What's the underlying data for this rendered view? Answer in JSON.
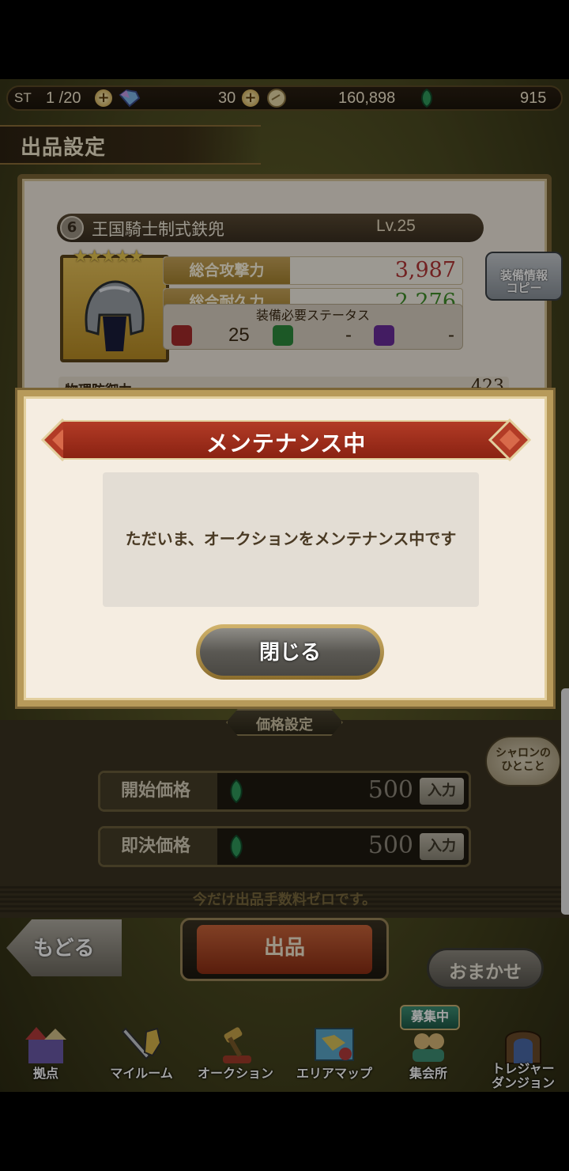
{
  "status": {
    "st_label": "ST",
    "stamina": "1 /20",
    "gems": "30",
    "gold": "160,898",
    "emeralds": "915"
  },
  "header": {
    "title": "出品設定"
  },
  "item": {
    "rank": "6",
    "name": "王国騎士制式鉄兜",
    "level": "Lv.25",
    "stars": "★★★★★",
    "stats": [
      {
        "label": "総合攻撃力",
        "value": "3,987",
        "color": "#b23636"
      },
      {
        "label": "総合耐久力",
        "value": "2,276",
        "color": "#3f8f2a"
      }
    ],
    "requirements": {
      "title": "装備必要ステータス",
      "str": "25",
      "dex": "-",
      "int": "-"
    },
    "defense": {
      "label": "物理防御力",
      "value": "423"
    },
    "copy_button": "装備情報\nコピー"
  },
  "dialog": {
    "title": "メンテナンス中",
    "message": "ただいま、オークションをメンテナンス中です",
    "close_button": "閉じる"
  },
  "price": {
    "tab": "価格設定",
    "start_label": "開始価格",
    "start_value": "500",
    "buyout_label": "即決価格",
    "buyout_value": "500",
    "input_label": "入力",
    "notice": "今だけ出品手数料ゼロです。"
  },
  "sharon_button": "シャロンの\nひとこと",
  "actions": {
    "back": "もどる",
    "list": "出品",
    "omakase": "おまかせ"
  },
  "nav": {
    "recruit_badge": "募集中",
    "items": [
      {
        "label": "拠点"
      },
      {
        "label": "マイルーム"
      },
      {
        "label": "オークション"
      },
      {
        "label": "エリアマップ"
      },
      {
        "label": "集会所"
      },
      {
        "label": "トレジャー\nダンジョン"
      }
    ]
  }
}
